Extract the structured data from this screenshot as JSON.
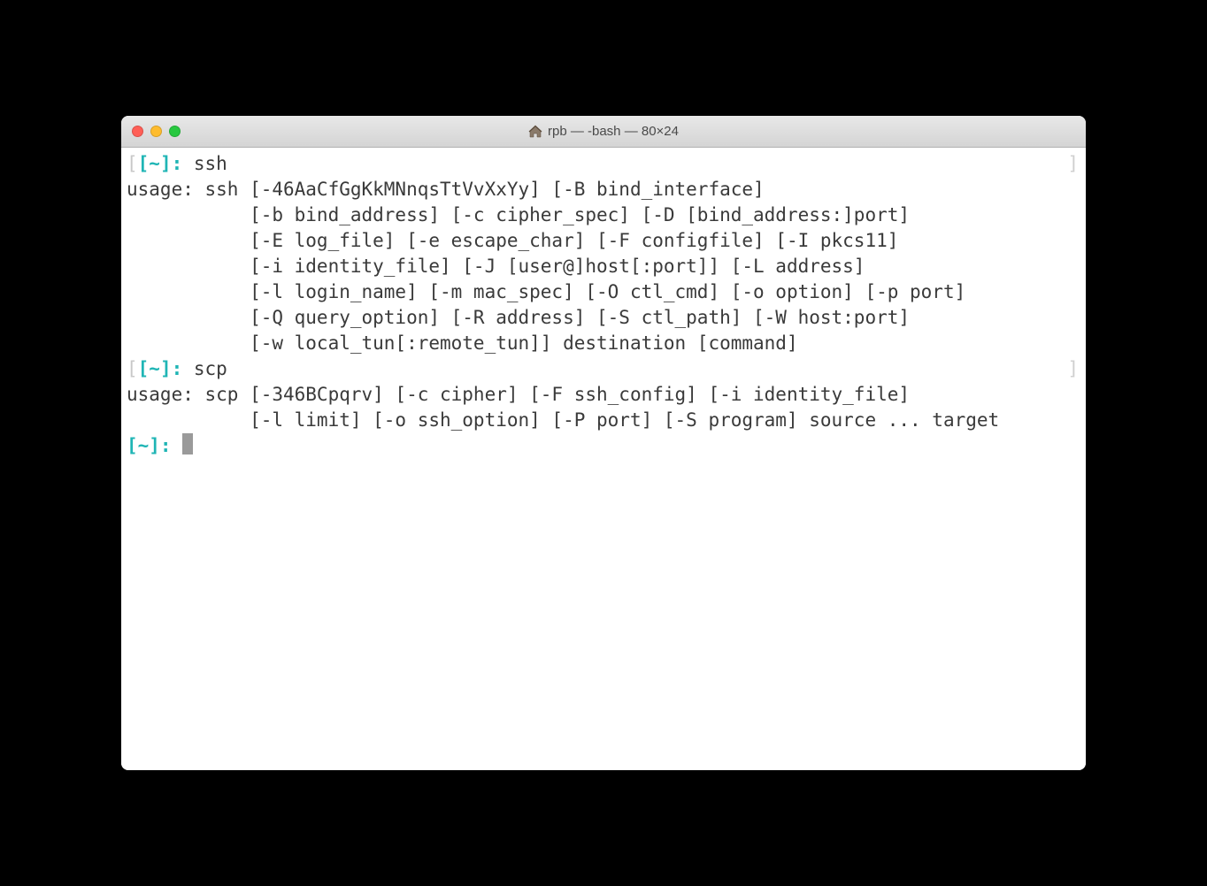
{
  "window": {
    "title": "rpb — -bash — 80×24"
  },
  "terminal": {
    "prompt_label": "[~]:",
    "lines": [
      {
        "type": "prompt_cmd",
        "cmd": "ssh",
        "left_bracket": true,
        "right_bracket": true
      },
      {
        "type": "out",
        "text": "usage: ssh [-46AaCfGgKkMNnqsTtVvXxYy] [-B bind_interface]"
      },
      {
        "type": "out",
        "text": "           [-b bind_address] [-c cipher_spec] [-D [bind_address:]port]"
      },
      {
        "type": "out",
        "text": "           [-E log_file] [-e escape_char] [-F configfile] [-I pkcs11]"
      },
      {
        "type": "out",
        "text": "           [-i identity_file] [-J [user@]host[:port]] [-L address]"
      },
      {
        "type": "out",
        "text": "           [-l login_name] [-m mac_spec] [-O ctl_cmd] [-o option] [-p port]"
      },
      {
        "type": "out",
        "text": "           [-Q query_option] [-R address] [-S ctl_path] [-W host:port]"
      },
      {
        "type": "out",
        "text": "           [-w local_tun[:remote_tun]] destination [command]"
      },
      {
        "type": "prompt_cmd",
        "cmd": "scp",
        "left_bracket": true,
        "right_bracket": true
      },
      {
        "type": "out",
        "text": "usage: scp [-346BCpqrv] [-c cipher] [-F ssh_config] [-i identity_file]"
      },
      {
        "type": "out",
        "text": "           [-l limit] [-o ssh_option] [-P port] [-S program] source ... target"
      },
      {
        "type": "prompt_cursor"
      }
    ]
  }
}
